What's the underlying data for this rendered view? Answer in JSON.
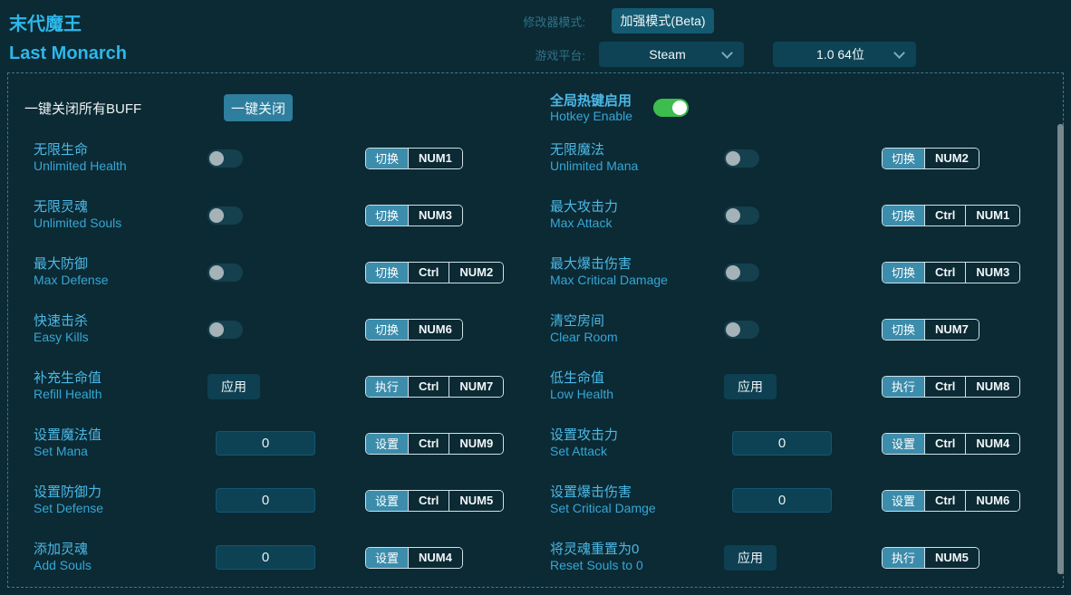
{
  "window": {
    "title_zh": "末代魔王",
    "title_en": "Last Monarch"
  },
  "header": {
    "mode_label": "修改器模式:",
    "mode_button_label": "加强模式(Beta)",
    "platform_label": "游戏平台:",
    "platform_selected": "Steam",
    "version_selected": "1.0 64位"
  },
  "master": {
    "buff_label": "一键关闭所有BUFF",
    "buff_button_label": "一键关闭",
    "hotkey_enable_zh": "全局热键启用",
    "hotkey_enable_en": "Hotkey Enable",
    "hotkey_enabled": true
  },
  "strings": {
    "apply": "应用"
  },
  "cheats": [
    {
      "zh": "无限生命",
      "en": "Unlimited Health",
      "type": "toggle",
      "state": "off",
      "action": "切换",
      "keys": [
        "NUM1"
      ]
    },
    {
      "zh": "无限魔法",
      "en": "Unlimited Mana",
      "type": "toggle",
      "state": "off",
      "action": "切换",
      "keys": [
        "NUM2"
      ]
    },
    {
      "zh": "无限灵魂",
      "en": "Unlimited Souls",
      "type": "toggle",
      "state": "off",
      "action": "切换",
      "keys": [
        "NUM3"
      ]
    },
    {
      "zh": "最大攻击力",
      "en": "Max Attack",
      "type": "toggle",
      "state": "off",
      "action": "切换",
      "keys": [
        "Ctrl",
        "NUM1"
      ]
    },
    {
      "zh": "最大防御",
      "en": "Max Defense",
      "type": "toggle",
      "state": "off",
      "action": "切换",
      "keys": [
        "Ctrl",
        "NUM2"
      ]
    },
    {
      "zh": "最大爆击伤害",
      "en": "Max Critical Damage",
      "type": "toggle",
      "state": "off",
      "action": "切换",
      "keys": [
        "Ctrl",
        "NUM3"
      ]
    },
    {
      "zh": "快速击杀",
      "en": "Easy Kills",
      "type": "toggle",
      "state": "off",
      "action": "切换",
      "keys": [
        "NUM6"
      ]
    },
    {
      "zh": "清空房间",
      "en": "Clear Room",
      "type": "toggle",
      "state": "off",
      "action": "切换",
      "keys": [
        "NUM7"
      ]
    },
    {
      "zh": "补充生命值",
      "en": "Refill Health",
      "type": "apply",
      "action": "执行",
      "keys": [
        "Ctrl",
        "NUM7"
      ]
    },
    {
      "zh": "低生命值",
      "en": "Low Health",
      "type": "apply",
      "action": "执行",
      "keys": [
        "Ctrl",
        "NUM8"
      ]
    },
    {
      "zh": "设置魔法值",
      "en": "Set Mana",
      "type": "input",
      "value": "0",
      "action": "设置",
      "keys": [
        "Ctrl",
        "NUM9"
      ]
    },
    {
      "zh": "设置攻击力",
      "en": "Set Attack",
      "type": "input",
      "value": "0",
      "action": "设置",
      "keys": [
        "Ctrl",
        "NUM4"
      ]
    },
    {
      "zh": "设置防御力",
      "en": "Set Defense",
      "type": "input",
      "value": "0",
      "action": "设置",
      "keys": [
        "Ctrl",
        "NUM5"
      ]
    },
    {
      "zh": "设置爆击伤害",
      "en": "Set Critical Damge",
      "type": "input",
      "value": "0",
      "action": "设置",
      "keys": [
        "Ctrl",
        "NUM6"
      ]
    },
    {
      "zh": "添加灵魂",
      "en": "Add Souls",
      "type": "input",
      "value": "0",
      "action": "设置",
      "keys": [
        "NUM4"
      ]
    },
    {
      "zh": "将灵魂重置为0",
      "en": "Reset Souls to 0",
      "type": "apply",
      "action": "执行",
      "keys": [
        "NUM5"
      ]
    }
  ],
  "colors": {
    "background": "#0b2a34",
    "accent_cyan": "#2db7ea",
    "label_cyan": "#4cb8e6",
    "button_blue": "#2e7e9d",
    "hotkey_fill": "#3c8cab",
    "toggle_on_green": "#3cbd4e",
    "panel_border": "#3e7992"
  }
}
